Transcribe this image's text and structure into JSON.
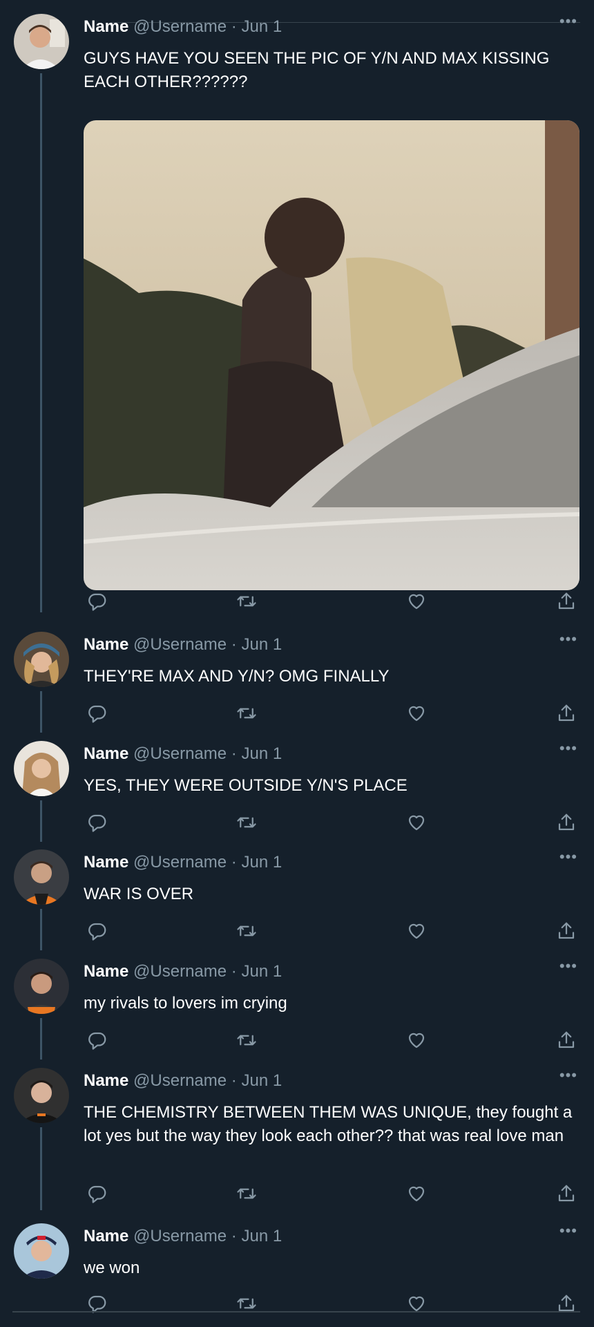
{
  "theme": {
    "background": "#15202b",
    "text": "#ffffff",
    "muted": "#8899a6",
    "thread_line": "#3d5466"
  },
  "tweets": [
    {
      "name": "Name",
      "handle": "@Username",
      "dot": "·",
      "date": "Jun 1",
      "text": "GUYS HAVE YOU SEEN THE PIC OF Y/N AND MAX KISSING EACH OTHER??????",
      "has_media": true
    },
    {
      "name": "Name",
      "handle": "@Username",
      "dot": "·",
      "date": "Jun 1",
      "text": "THEY'RE MAX AND Y/N? OMG FINALLY"
    },
    {
      "name": "Name",
      "handle": "@Username",
      "dot": "·",
      "date": "Jun 1",
      "text": "YES, THEY WERE OUTSIDE Y/N'S PLACE"
    },
    {
      "name": "Name",
      "handle": "@Username",
      "dot": "·",
      "date": "Jun 1",
      "text": "WAR IS OVER"
    },
    {
      "name": "Name",
      "handle": "@Username",
      "dot": "·",
      "date": "Jun 1",
      "text": "my rivals to lovers im crying"
    },
    {
      "name": "Name",
      "handle": "@Username",
      "dot": "·",
      "date": "Jun 1",
      "text": "THE CHEMISTRY BETWEEN THEM WAS UNIQUE, they fought a lot yes but the way they look each other?? that was real love man"
    },
    {
      "name": "Name",
      "handle": "@Username",
      "dot": "·",
      "date": "Jun 1",
      "text": "we won"
    }
  ],
  "more_glyph": "•••",
  "icons": {
    "reply": "reply-icon",
    "retweet": "retweet-icon",
    "like": "like-icon",
    "share": "share-icon",
    "more": "more-icon"
  }
}
